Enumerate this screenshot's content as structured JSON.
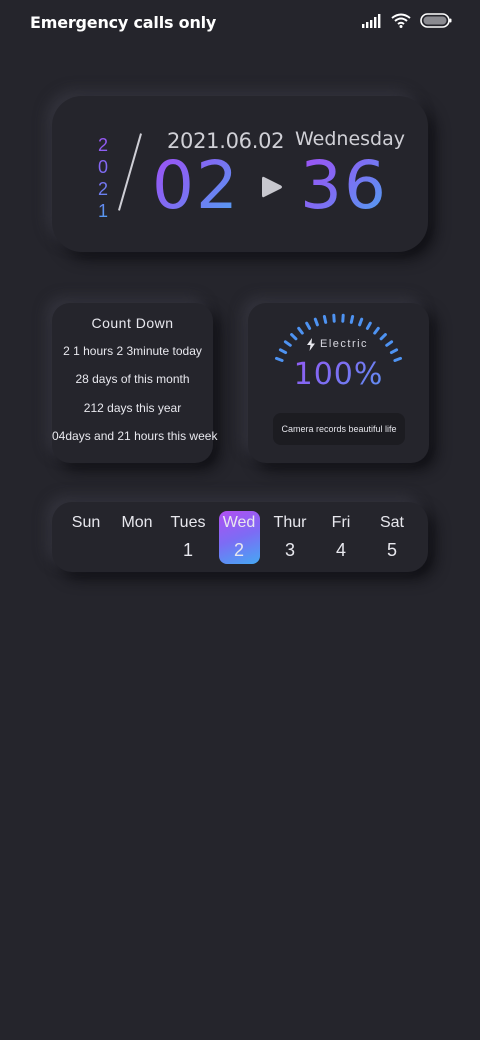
{
  "status_bar": {
    "carrier_text": "Emergency calls only",
    "icons": [
      "signal-icon",
      "wifi-icon",
      "battery-icon"
    ]
  },
  "clock": {
    "year_digits": [
      "2",
      "0",
      "2",
      "1"
    ],
    "date": "2021.06.02",
    "weekday": "Wednesday",
    "hour": "02",
    "minute": "36",
    "separator_icon": "play-icon"
  },
  "countdown": {
    "title": "Count Down",
    "lines": [
      "2 1 hours 2 3minute today",
      "28  days of this month",
      "212   days this year",
      "04days and 21 hours this week"
    ]
  },
  "electric": {
    "label": "Electric",
    "value": "100%",
    "level": 1.0,
    "caption": "Camera records beautiful life",
    "icon": "bolt-icon"
  },
  "calendar": {
    "days": [
      {
        "name": "Sun",
        "num": ""
      },
      {
        "name": "Mon",
        "num": ""
      },
      {
        "name": "Tues",
        "num": "1"
      },
      {
        "name": "Wed",
        "num": "2"
      },
      {
        "name": "Thur",
        "num": "3"
      },
      {
        "name": "Fri",
        "num": "4"
      },
      {
        "name": "Sat",
        "num": "5"
      }
    ],
    "active_index": 3
  },
  "colors": {
    "background": "#25252c",
    "gradient_start": "#a24ef5",
    "gradient_end": "#4aa7f0"
  }
}
